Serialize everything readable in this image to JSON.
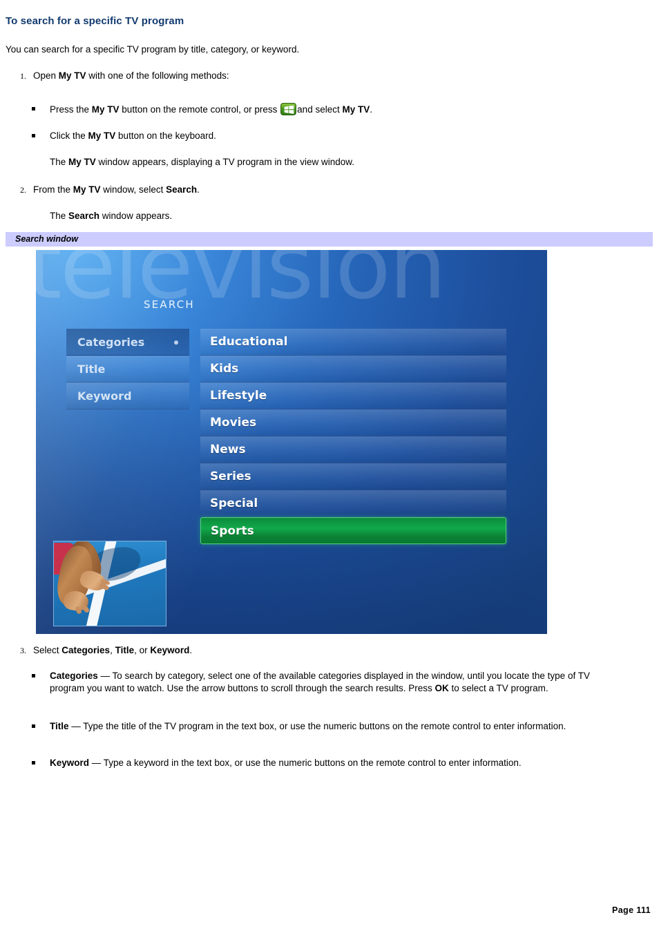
{
  "document": {
    "heading": "To search for a specific TV program",
    "intro": "You can search for a specific TV program by title, category, or keyword.",
    "footer": "Page 111"
  },
  "steps": [
    {
      "number": "1.",
      "lead": "Open ",
      "bold1": "My TV",
      "tail": " with one of the following methods:"
    },
    {
      "number": "2.",
      "lead": "From the ",
      "bold1": "My TV",
      "mid": " window, select ",
      "bold2": "Search",
      "tail": "."
    },
    {
      "number": "3.",
      "lead": "Select ",
      "bold1": "Categories",
      "sep1": ", ",
      "bold2": "Title",
      "sep2": ", or ",
      "bold3": "Keyword",
      "tail": "."
    }
  ],
  "step1_bullets": [
    {
      "part1": "Press the ",
      "bold1": "My TV",
      "part2": " button on the remote control, or press ",
      "icon": "windows-start-icon",
      "part3": "and select ",
      "bold2": "My TV",
      "part4": "."
    },
    {
      "part1": "Click the ",
      "bold1": "My TV",
      "part2": " button on the keyboard.",
      "bold2": "",
      "part3": "",
      "part4": ""
    }
  ],
  "step1_note": {
    "part1": "The ",
    "bold1": "My TV",
    "part2": " window appears, displaying a TV program in the view window."
  },
  "step2_note": {
    "part1": "The ",
    "bold1": "Search",
    "part2": " window appears."
  },
  "figure": {
    "caption": "Search window",
    "watermark": "television",
    "screen_title": "SEARCH",
    "nav_items": [
      {
        "label": "Categories",
        "active": true,
        "marker": "selection-dot"
      },
      {
        "label": "Title",
        "active": false,
        "marker": ""
      },
      {
        "label": "Keyword",
        "active": false,
        "marker": ""
      }
    ],
    "categories": [
      {
        "label": "Educational",
        "selected": false
      },
      {
        "label": "Kids",
        "selected": false
      },
      {
        "label": "Lifestyle",
        "selected": false
      },
      {
        "label": "Movies",
        "selected": false
      },
      {
        "label": "News",
        "selected": false
      },
      {
        "label": "Series",
        "selected": false
      },
      {
        "label": "Special",
        "selected": false
      },
      {
        "label": "Sports",
        "selected": true
      }
    ],
    "thumbnail_alt": "sprinter-hands-on-track-photo",
    "colors": {
      "selected_green": "#11a84a",
      "panel_blue": "#2562b5",
      "caption_bar": "#ccccff",
      "heading_navy": "#123a6e"
    }
  },
  "step3_bullets": [
    {
      "bold": "Categories",
      "dash": " — ",
      "text": "To search by category, select one of the available categories displayed in the window, until you locate the type of TV program you want to watch. Use the arrow buttons to scroll through the search results. Press ",
      "bold_inline": "OK",
      "text_tail": " to select a TV program."
    },
    {
      "bold": "Title",
      "dash": " — ",
      "text": "Type the title of the TV program in the text box, or use the numeric buttons on the remote control to enter information.",
      "bold_inline": "",
      "text_tail": ""
    },
    {
      "bold": "Keyword",
      "dash": " — ",
      "text": "Type a keyword in the text box, or use the numeric buttons on the remote control to enter information.",
      "bold_inline": "",
      "text_tail": ""
    }
  ]
}
